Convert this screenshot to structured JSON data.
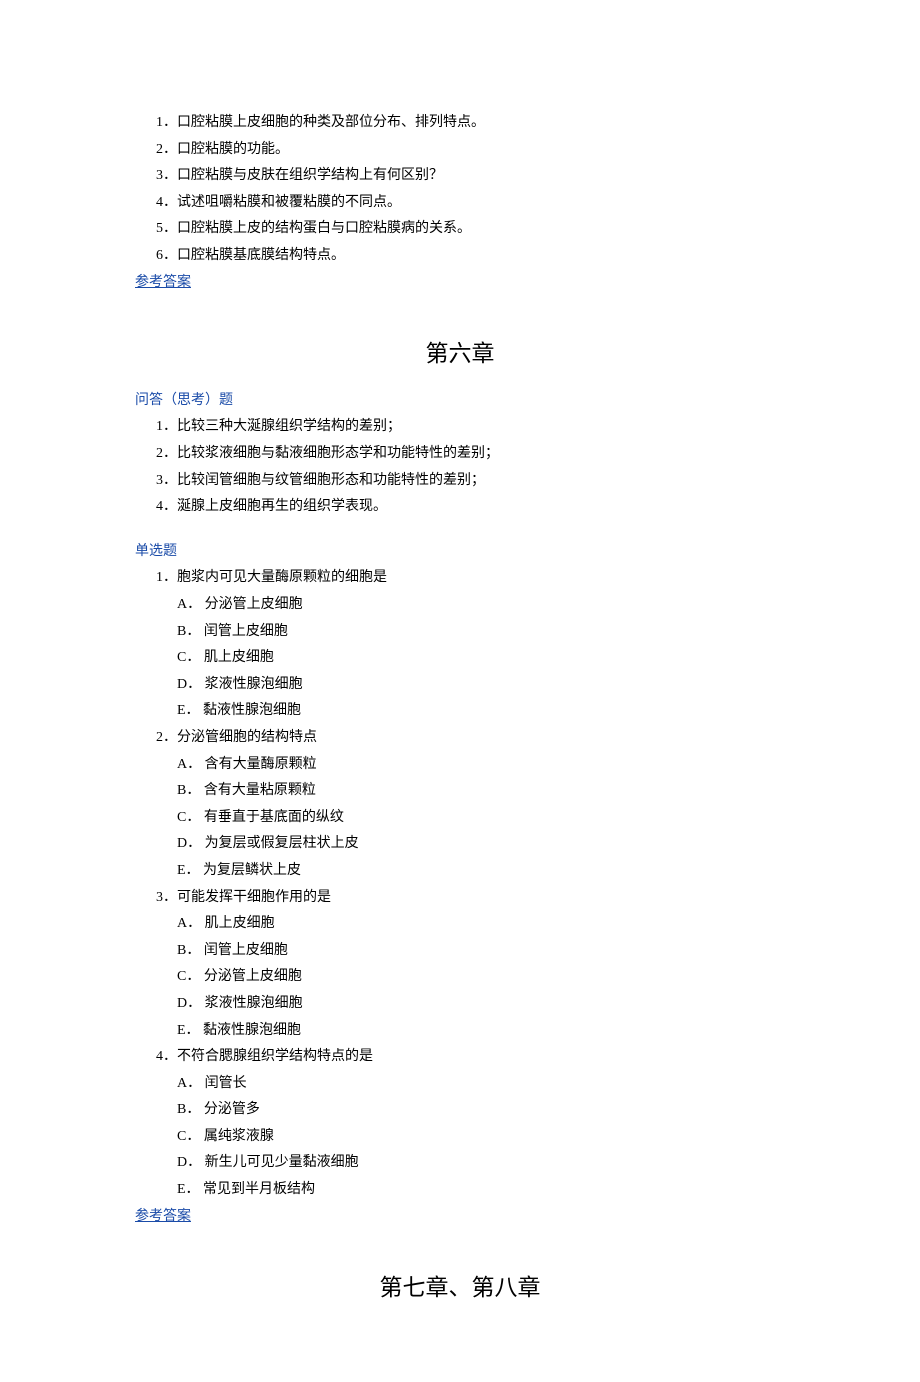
{
  "chapter5": {
    "questions": [
      "1．口腔粘膜上皮细胞的种类及部位分布、排列特点。",
      "2．口腔粘膜的功能。",
      "3．口腔粘膜与皮肤在组织学结构上有何区别？",
      "4．试述咀嚼粘膜和被覆粘膜的不同点。",
      "5．口腔粘膜上皮的结构蛋白与口腔粘膜病的关系。",
      "6．口腔粘膜基底膜结构特点。"
    ],
    "answer_link": "参考答案"
  },
  "chapter6": {
    "title": "第六章",
    "essay_header": "问答（思考）题",
    "essay": [
      "1．比较三种大涎腺组织学结构的差别；",
      "2．比较浆液细胞与黏液细胞形态学和功能特性的差别；",
      "3．比较闰管细胞与纹管细胞形态和功能特性的差别；",
      "4．涎腺上皮细胞再生的组织学表现。"
    ],
    "mcq_header": "单选题",
    "mcq": [
      {
        "stem": "1．胞浆内可见大量酶原颗粒的细胞是",
        "opts": [
          "A．  分泌管上皮细胞",
          "B．  闰管上皮细胞",
          "C．  肌上皮细胞",
          "D．  浆液性腺泡细胞",
          "E．  黏液性腺泡细胞"
        ]
      },
      {
        "stem": "2．分泌管细胞的结构特点",
        "opts": [
          "A．  含有大量酶原颗粒",
          "B．  含有大量粘原颗粒",
          "C．  有垂直于基底面的纵纹",
          "D．  为复层或假复层柱状上皮",
          "E．  为复层鳞状上皮"
        ]
      },
      {
        "stem": "3．可能发挥干细胞作用的是",
        "opts": [
          "A．  肌上皮细胞",
          "B．  闰管上皮细胞",
          "C．  分泌管上皮细胞",
          "D．  浆液性腺泡细胞",
          "E．  黏液性腺泡细胞"
        ]
      },
      {
        "stem": "4．不符合腮腺组织学结构特点的是",
        "opts": [
          "A．  闰管长",
          "B．  分泌管多",
          "C．  属纯浆液腺",
          "D．  新生儿可见少量黏液细胞",
          "E．  常见到半月板结构"
        ]
      }
    ],
    "answer_link": "参考答案"
  },
  "chapter7": {
    "title": "第七章、第八章"
  }
}
